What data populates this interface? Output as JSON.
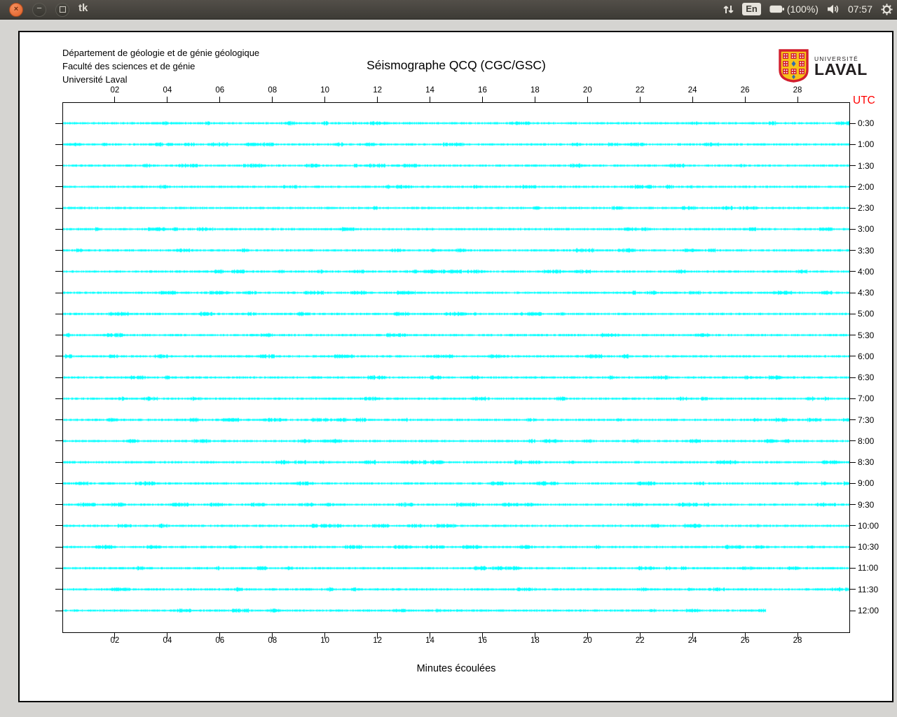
{
  "topbar": {
    "window_title": "tk",
    "controls": {
      "close_glyph": "×",
      "minimize_glyph": "−"
    },
    "icons": [
      "network-updown-arrows-icon",
      "keyboard-layout-badge",
      "battery-icon",
      "volume-icon",
      "session-gear-icon"
    ],
    "tray": {
      "keyboard_layout": "En",
      "battery_percent": "(100%)",
      "clock": "07:57"
    }
  },
  "app": {
    "header": {
      "address_lines": [
        "Département de géologie et de génie géologique",
        "Faculté des sciences et de génie",
        "Université Laval"
      ],
      "title": "Séismographe QCQ (CGC/GSC)",
      "logo": {
        "line1": "UNIVERSITÉ",
        "line2": "LAVAL"
      }
    },
    "chart_data": {
      "type": "line",
      "subtype": "seismograph-helicorder",
      "title": "Séismographe QCQ (CGC/GSC)",
      "xlabel": "Minutes écoulées",
      "x_range_minutes": [
        0,
        30
      ],
      "x_ticks": [
        "02",
        "04",
        "06",
        "08",
        "10",
        "12",
        "14",
        "16",
        "18",
        "20",
        "22",
        "24",
        "26",
        "28"
      ],
      "right_axis_label": "UTC",
      "right_axis_color": "#ff0000",
      "trace_color": "#00ffff",
      "trace_description": "flat background-noise traces, one 30-minute line per half hour",
      "rows": [
        {
          "utc": "0:30",
          "end_minute": 30
        },
        {
          "utc": "1:00",
          "end_minute": 30
        },
        {
          "utc": "1:30",
          "end_minute": 30
        },
        {
          "utc": "2:00",
          "end_minute": 30
        },
        {
          "utc": "2:30",
          "end_minute": 30
        },
        {
          "utc": "3:00",
          "end_minute": 30
        },
        {
          "utc": "3:30",
          "end_minute": 30
        },
        {
          "utc": "4:00",
          "end_minute": 30
        },
        {
          "utc": "4:30",
          "end_minute": 30
        },
        {
          "utc": "5:00",
          "end_minute": 30
        },
        {
          "utc": "5:30",
          "end_minute": 30
        },
        {
          "utc": "6:00",
          "end_minute": 30
        },
        {
          "utc": "6:30",
          "end_minute": 30
        },
        {
          "utc": "7:00",
          "end_minute": 30
        },
        {
          "utc": "7:30",
          "end_minute": 30
        },
        {
          "utc": "8:00",
          "end_minute": 30
        },
        {
          "utc": "8:30",
          "end_minute": 30
        },
        {
          "utc": "9:00",
          "end_minute": 30
        },
        {
          "utc": "9:30",
          "end_minute": 30
        },
        {
          "utc": "10:00",
          "end_minute": 30
        },
        {
          "utc": "10:30",
          "end_minute": 30
        },
        {
          "utc": "11:00",
          "end_minute": 30
        },
        {
          "utc": "11:30",
          "end_minute": 30
        },
        {
          "utc": "12:00",
          "end_minute": 26.8
        }
      ]
    }
  }
}
